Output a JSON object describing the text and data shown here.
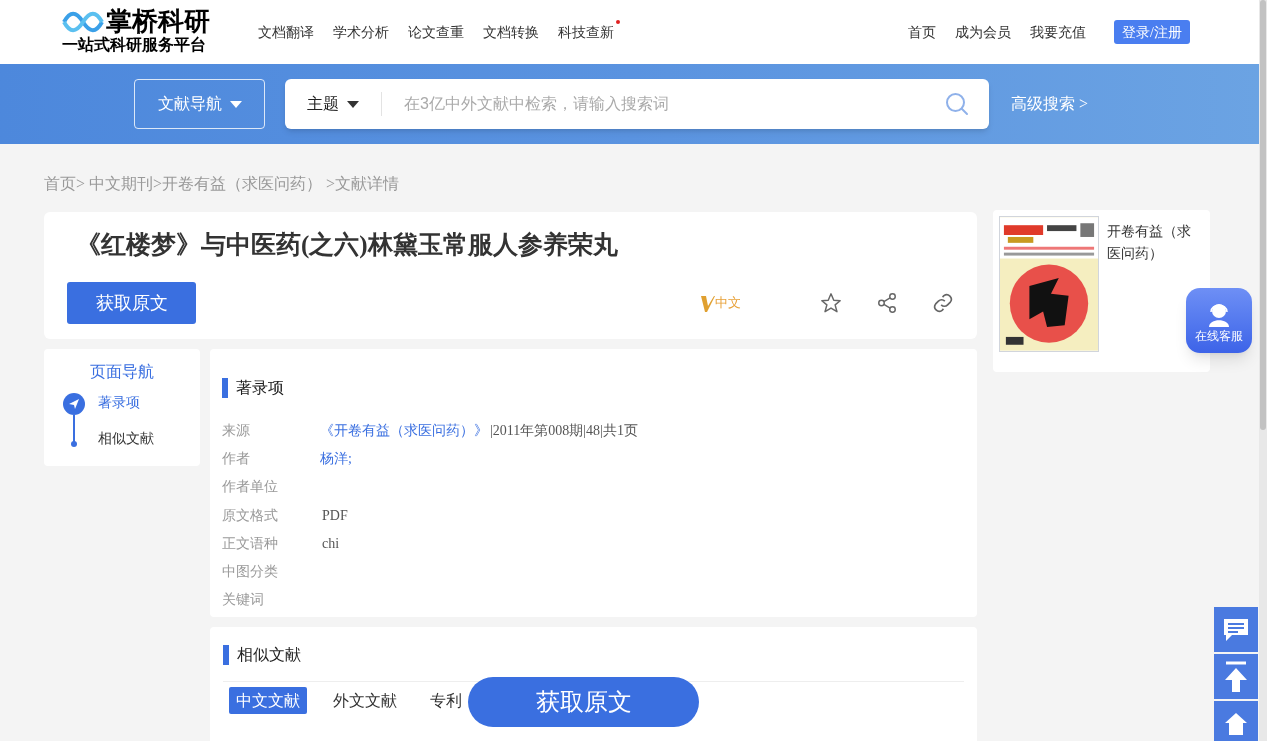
{
  "logo": {
    "name": "掌桥科研",
    "slogan": "一站式科研服务平台"
  },
  "nav": [
    {
      "label": "文档翻译",
      "dot": false
    },
    {
      "label": "学术分析",
      "dot": false
    },
    {
      "label": "论文查重",
      "dot": false
    },
    {
      "label": "文档转换",
      "dot": false
    },
    {
      "label": "科技查新",
      "dot": true
    }
  ],
  "top_links": [
    "首页",
    "成为会员",
    "我要充值"
  ],
  "login_button": "登录/注册",
  "search": {
    "nav_button": "文献导航",
    "scope": "主题",
    "placeholder": "在3亿中外文献中检索，请输入搜索词",
    "advanced": "高级搜索 >"
  },
  "breadcrumb": "首页> 中文期刊>开卷有益（求医问药） >文献详情",
  "article": {
    "title": "《红楼梦》与中医药(之六)林黛玉常服人参养荣丸",
    "get_button": "获取原文",
    "language_badge": "中文"
  },
  "page_nav": {
    "title": "页面导航",
    "items": [
      {
        "label": "著录项",
        "selected": true
      },
      {
        "label": "相似文献",
        "selected": false
      }
    ]
  },
  "record": {
    "heading": "著录项",
    "fields": [
      {
        "label": "来源",
        "link": "《开卷有益（求医问药）》",
        "value": "|2011年第008期|48|共1页"
      },
      {
        "label": "作者",
        "link": "杨洋;"
      },
      {
        "label": "作者单位"
      },
      {
        "label": "原文格式",
        "value": "PDF"
      },
      {
        "label": "正文语种",
        "value": "chi"
      },
      {
        "label": "中图分类"
      },
      {
        "label": "关键词"
      }
    ]
  },
  "similar": {
    "heading": "相似文献",
    "tabs": [
      {
        "label": "中文文献",
        "selected": true
      },
      {
        "label": "外文文献",
        "selected": false
      },
      {
        "label": "专利",
        "selected": false
      }
    ]
  },
  "journal": {
    "name": "开卷有益（求医问药）"
  },
  "service_badge": "在线客服",
  "floating_button": "获取原文"
}
